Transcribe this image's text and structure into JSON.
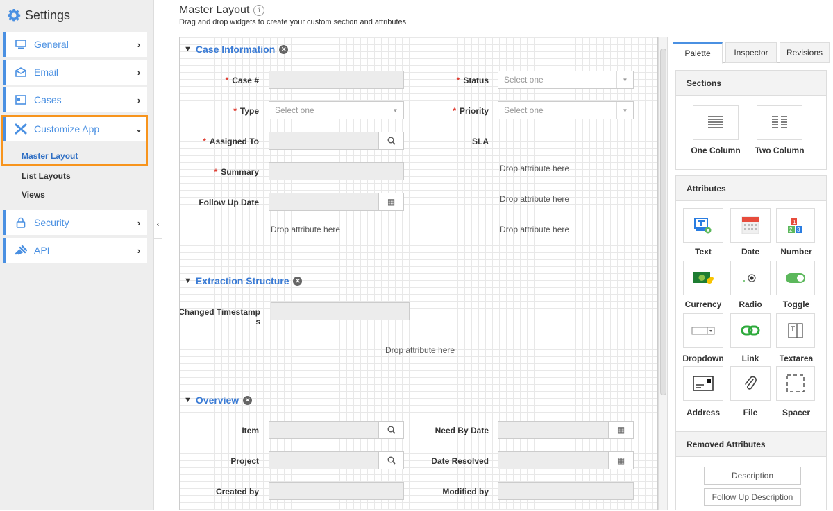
{
  "sidebar": {
    "title": "Settings",
    "items": [
      {
        "label": "General"
      },
      {
        "label": "Email"
      },
      {
        "label": "Cases"
      },
      {
        "label": "Customize App"
      },
      {
        "label": "Security"
      },
      {
        "label": "API"
      }
    ],
    "subitems": [
      {
        "label": "Master Layout"
      },
      {
        "label": "List Layouts"
      },
      {
        "label": "Views"
      }
    ]
  },
  "header": {
    "title": "Master Layout",
    "subtitle": "Drag and drop widgets to create your custom section and attributes"
  },
  "sections": [
    {
      "title": "Case Information"
    },
    {
      "title": "Extraction Structure"
    },
    {
      "title": "Overview"
    }
  ],
  "fields": {
    "case_no": "Case #",
    "status": "Status",
    "type": "Type",
    "priority": "Priority",
    "assigned_to": "Assigned To",
    "sla": "SLA",
    "summary": "Summary",
    "follow_up": "Follow Up Date",
    "changed_ts": "Changed Timestamps",
    "item": "Item",
    "need_by": "Need By Date",
    "project": "Project",
    "date_resolved": "Date Resolved",
    "created_by": "Created by",
    "modified_by": "Modified by"
  },
  "select_placeholder": "Select one",
  "drop_text": "Drop attribute here",
  "panel": {
    "tabs": [
      "Palette",
      "Inspector",
      "Revisions"
    ],
    "sections_title": "Sections",
    "section_cards": [
      "One Column",
      "Two Column"
    ],
    "attributes_title": "Attributes",
    "attributes": [
      "Text",
      "Date",
      "Number",
      "Currency",
      "Radio",
      "Toggle",
      "Dropdown",
      "Link",
      "Textarea",
      "Address",
      "File",
      "Spacer"
    ],
    "removed_title": "Removed Attributes",
    "removed": [
      "Description",
      "Follow Up Description"
    ]
  },
  "colors": {
    "accent": "#4a90e2",
    "highlight": "#f7941d",
    "required": "#e03c31"
  }
}
